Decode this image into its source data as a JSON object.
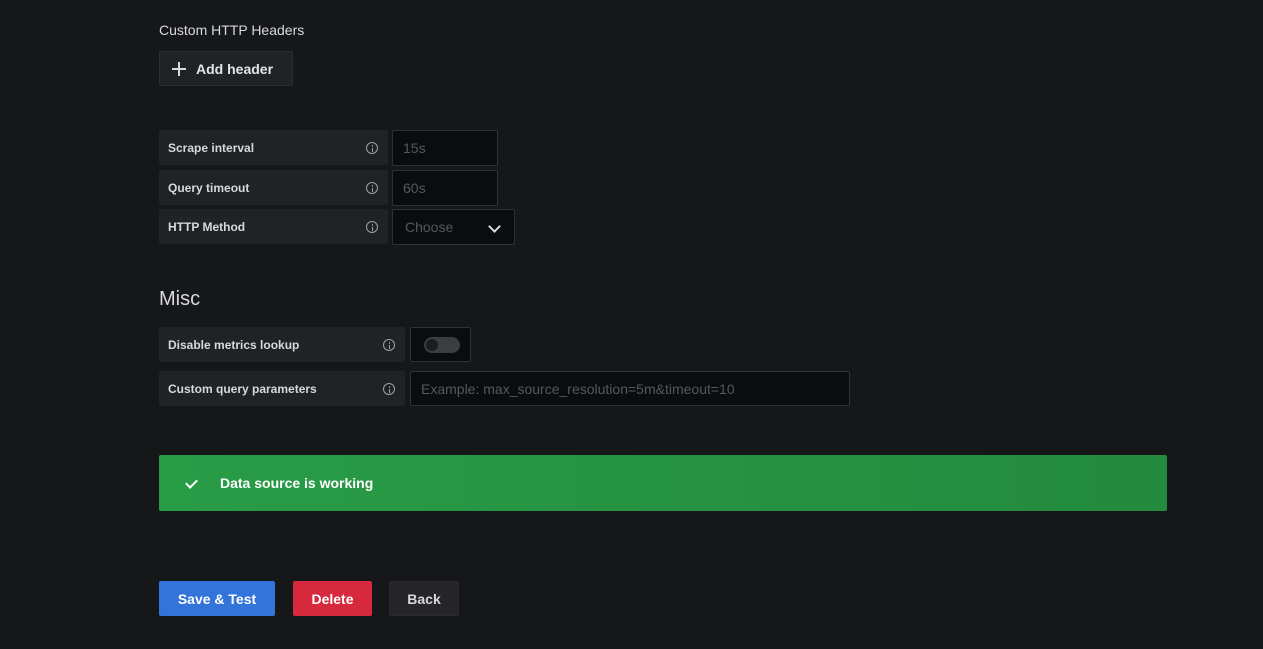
{
  "custom_headers": {
    "title": "Custom HTTP Headers",
    "add_button_label": "Add header"
  },
  "http_settings": {
    "scrape_interval": {
      "label": "Scrape interval",
      "placeholder": "15s"
    },
    "query_timeout": {
      "label": "Query timeout",
      "placeholder": "60s"
    },
    "http_method": {
      "label": "HTTP Method",
      "placeholder": "Choose"
    }
  },
  "misc": {
    "title": "Misc",
    "disable_metrics_lookup": {
      "label": "Disable metrics lookup",
      "enabled": false
    },
    "custom_query_parameters": {
      "label": "Custom query parameters",
      "placeholder": "Example: max_source_resolution=5m&timeout=10"
    }
  },
  "alert": {
    "message": "Data source is working",
    "color": "#299c46"
  },
  "actions": {
    "save_label": "Save & Test",
    "delete_label": "Delete",
    "back_label": "Back"
  },
  "colors": {
    "background": "#161719",
    "primary": "#3274d9",
    "danger": "#d6293e",
    "success": "#299c46"
  }
}
